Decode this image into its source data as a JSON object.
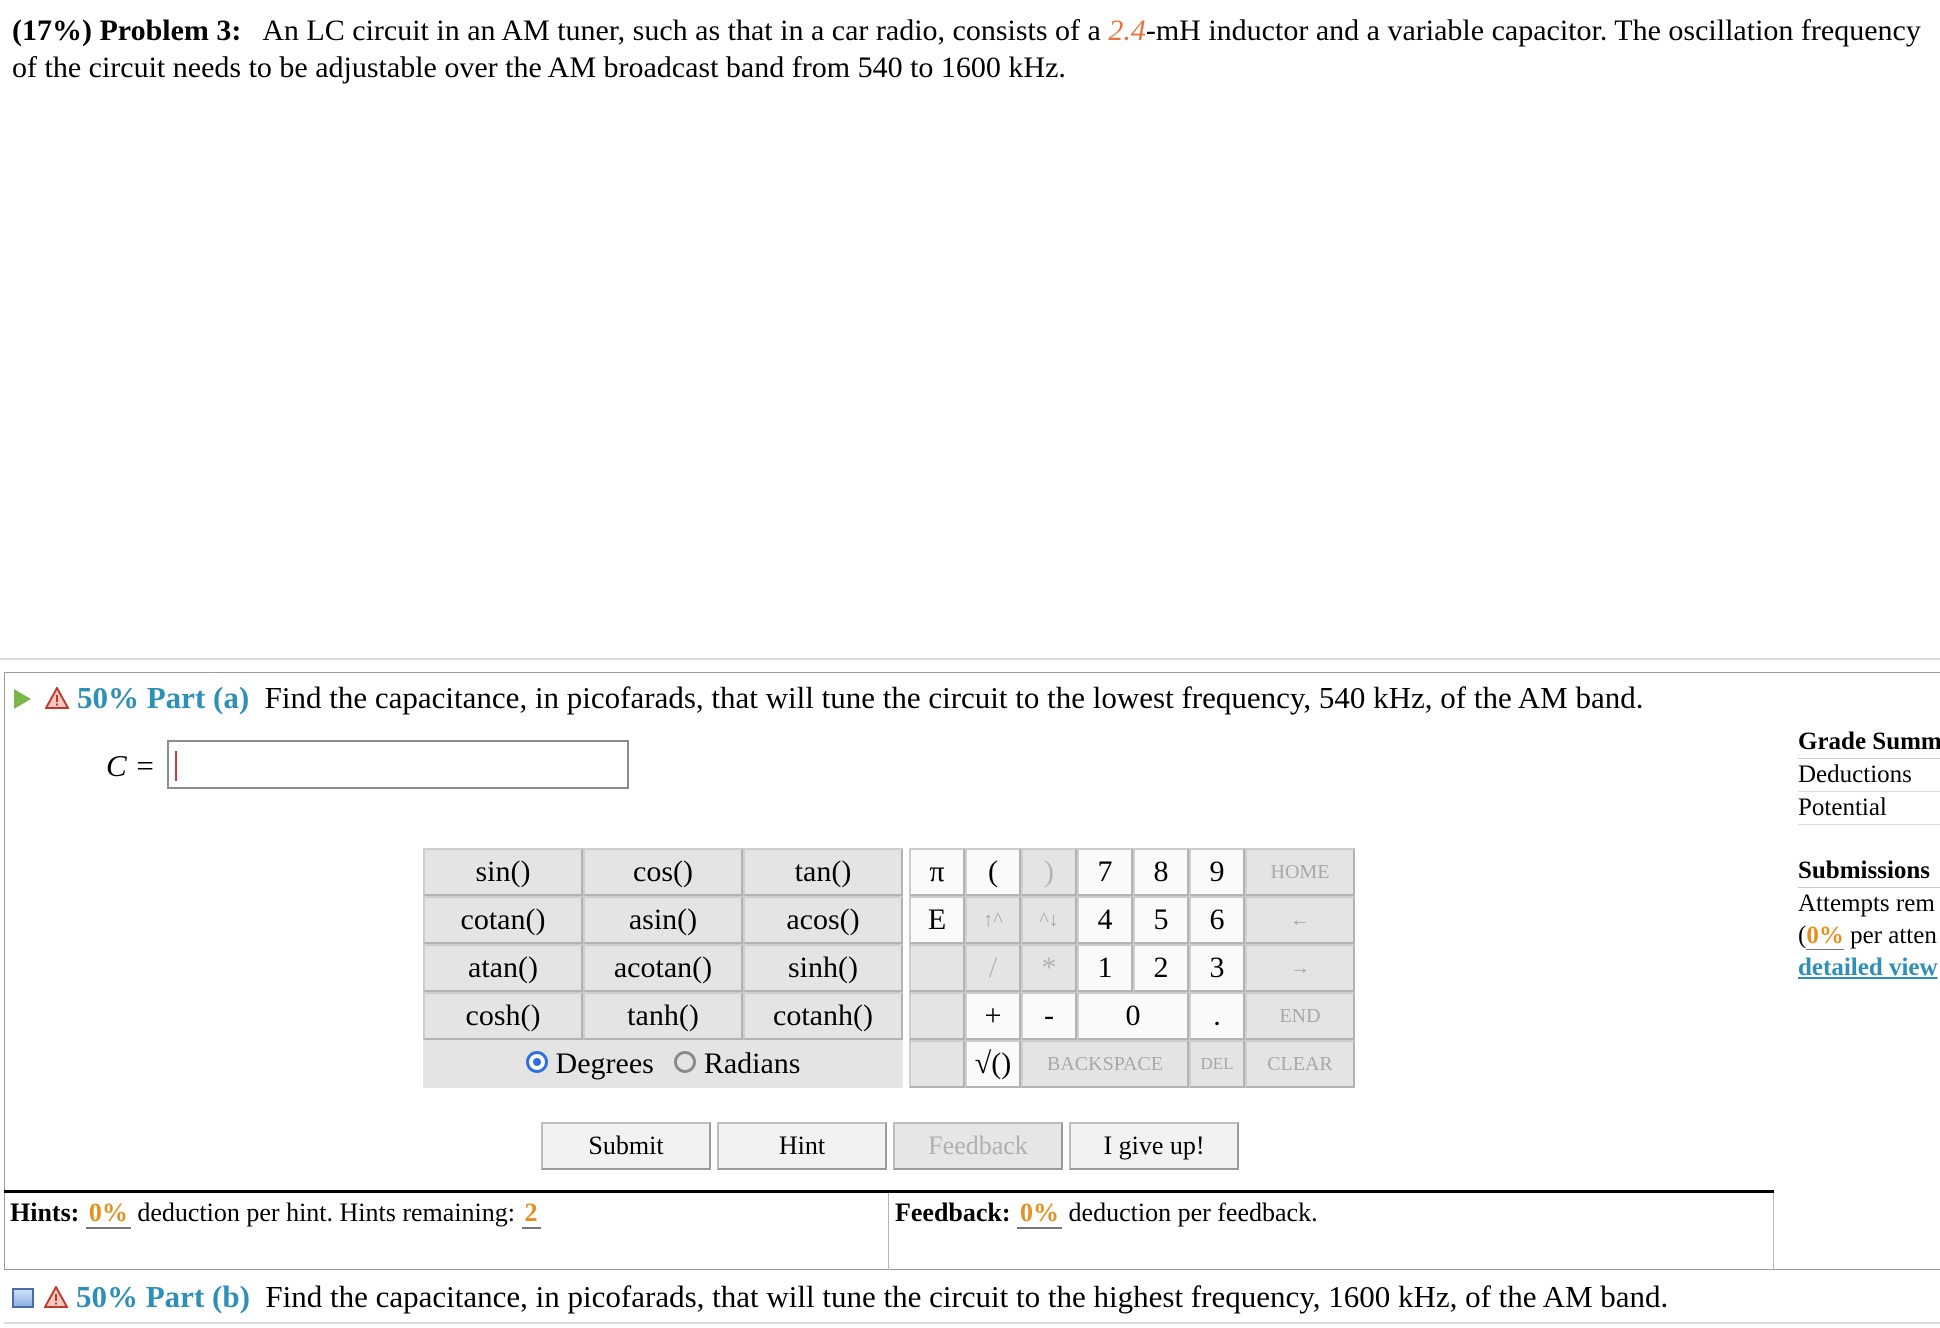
{
  "problem": {
    "number_label": "(17%) Problem 3:",
    "text_before": "An LC circuit in an AM tuner, such as that in a car radio, consists of a ",
    "highlight_value": "2.4",
    "text_after": "-mH inductor and a variable capacitor. The oscillation frequency of the circuit needs to be adjustable over the AM broadcast band from 540 to 1600 kHz."
  },
  "part_a": {
    "percent_label": "50% Part (a)",
    "question": "Find the capacitance, in picofarads, that will tune the circuit to the lowest frequency, 540 kHz, of the AM band.",
    "variable_label": "C =",
    "input_value": "",
    "input_placeholder": ""
  },
  "keypad": {
    "functions": [
      [
        "sin()",
        "cos()",
        "tan()"
      ],
      [
        "cotan()",
        "asin()",
        "acos()"
      ],
      [
        "atan()",
        "acotan()",
        "sinh()"
      ],
      [
        "cosh()",
        "tanh()",
        "cotanh()"
      ]
    ],
    "modes": {
      "degrees": "Degrees",
      "radians": "Radians",
      "selected": "Degrees"
    },
    "symbols": {
      "pi": "π",
      "e": "E",
      "open_paren": "(",
      "close_paren": ")",
      "up_caret": "↑^",
      "caret_down": "^↓",
      "divide": "/",
      "multiply": "*",
      "plus": "+",
      "minus": "-",
      "sqrt": "√()"
    },
    "digits": {
      "d7": "7",
      "d8": "8",
      "d9": "9",
      "d4": "4",
      "d5": "5",
      "d6": "6",
      "d1": "1",
      "d2": "2",
      "d3": "3",
      "d0": "0",
      "dot": "."
    },
    "nav": {
      "home": "HOME",
      "left": "←",
      "right": "→",
      "end": "END",
      "backspace": "BACKSPACE",
      "del": "DEL",
      "clear": "CLEAR"
    }
  },
  "actions": {
    "submit": "Submit",
    "hint": "Hint",
    "feedback": "Feedback",
    "give_up": "I give up!"
  },
  "hints": {
    "label": "Hints:",
    "deduction": "0%",
    "text": "deduction per hint. Hints remaining:",
    "remaining": "2"
  },
  "feedback": {
    "label": "Feedback:",
    "deduction": "0%",
    "text": "deduction per feedback."
  },
  "part_b": {
    "percent_label": "50% Part (b)",
    "question": "Find the capacitance, in picofarads, that will tune the circuit to the highest frequency, 1600 kHz, of the AM band."
  },
  "grade_summary": {
    "heading": "Grade Summ",
    "deductions": "Deductions",
    "potential": "Potential",
    "submissions_heading": "Submissions",
    "attempts": "Attempts rem",
    "per_attempt_pct": "0%",
    "per_attempt_text": "per atten",
    "detailed_view": "detailed view"
  },
  "colors": {
    "accent_blue": "#2e8fb8",
    "highlight_orange": "#e8743b",
    "deduction_orange": "#e8901e"
  }
}
